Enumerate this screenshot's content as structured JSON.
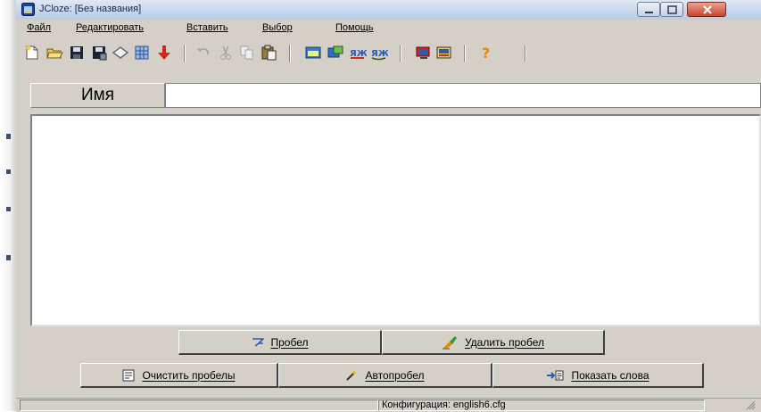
{
  "window": {
    "title": "JCloze: [Без названия]",
    "colors": {
      "face": "#d4d0c8",
      "title_gradient": "#c9d8ec",
      "close": "#c8442c"
    }
  },
  "menu": {
    "items": [
      {
        "label": "Файл"
      },
      {
        "label": "Редактировать"
      },
      {
        "label": "Вставить"
      },
      {
        "label": "Выбор"
      },
      {
        "label": "Помощь"
      }
    ]
  },
  "toolbar": {
    "icons": [
      "new-file-icon",
      "open-folder-icon",
      "save-icon",
      "save-as-icon",
      "diamond-icon",
      "grid-icon",
      "red-arrow-down-icon",
      "undo-icon",
      "cut-icon",
      "copy-icon",
      "paste-icon",
      "window-icon",
      "export-icon",
      "word-gap-icon",
      "word-gap-alt-icon",
      "monitor-icon",
      "config-icon",
      "help-icon"
    ]
  },
  "name_field": {
    "label": "Имя",
    "value": ""
  },
  "text_area": {
    "value": ""
  },
  "buttons": {
    "gap": "Пробел",
    "delete_gap": "Удалить пробел",
    "clear_gaps": "Очистить пробелы",
    "auto_gap": "Автопробел",
    "show_words": "Показать слова"
  },
  "status": {
    "config": "Конфигурация: english6.cfg"
  }
}
